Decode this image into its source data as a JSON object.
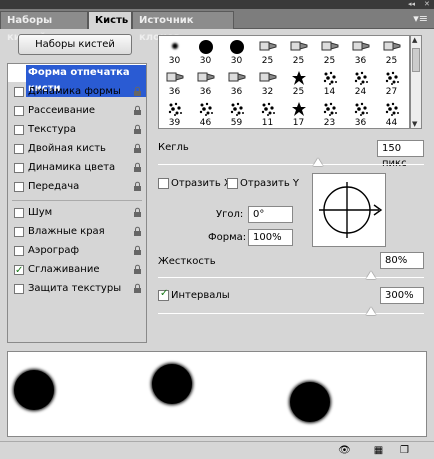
{
  "window": {
    "collapse_icon": "double-arrow-icon",
    "close_icon": "close-icon"
  },
  "tabs": [
    {
      "label": "Наборы кистей",
      "active": false
    },
    {
      "label": "Кисть",
      "active": true
    },
    {
      "label": "Источник клонов",
      "active": false
    }
  ],
  "panel_menu_icon": "panel-menu-icon",
  "presets_button": "Наборы кистей",
  "left_list": {
    "header": "Форма отпечатка кисти",
    "items": [
      {
        "label": "Динамика формы",
        "checked": false,
        "locked": true
      },
      {
        "label": "Рассеивание",
        "checked": false,
        "locked": true
      },
      {
        "label": "Текстура",
        "checked": false,
        "locked": true
      },
      {
        "label": "Двойная кисть",
        "checked": false,
        "locked": true
      },
      {
        "label": "Динамика цвета",
        "checked": false,
        "locked": true
      },
      {
        "label": "Передача",
        "checked": false,
        "locked": true
      },
      {
        "label": "Шум",
        "checked": false,
        "locked": true
      },
      {
        "label": "Влажные края",
        "checked": false,
        "locked": true
      },
      {
        "label": "Аэрограф",
        "checked": false,
        "locked": true
      },
      {
        "label": "Сглаживание",
        "checked": true,
        "locked": true
      },
      {
        "label": "Защита текстуры",
        "checked": false,
        "locked": true
      }
    ]
  },
  "brush_grid": {
    "rows": [
      [
        {
          "n": "30",
          "s": "soft"
        },
        {
          "n": "30",
          "s": "hard"
        },
        {
          "n": "30",
          "s": "hard"
        },
        {
          "n": "25",
          "s": "tip"
        },
        {
          "n": "25",
          "s": "tip"
        },
        {
          "n": "25",
          "s": "tip"
        },
        {
          "n": "36",
          "s": "tip"
        },
        {
          "n": "25",
          "s": "tip"
        }
      ],
      [
        {
          "n": "36",
          "s": "tip"
        },
        {
          "n": "36",
          "s": "tip"
        },
        {
          "n": "36",
          "s": "tip"
        },
        {
          "n": "32",
          "s": "tip"
        },
        {
          "n": "25",
          "s": "leaf"
        },
        {
          "n": "14",
          "s": "spray"
        },
        {
          "n": "24",
          "s": "spray"
        },
        {
          "n": "27",
          "s": "spray"
        }
      ],
      [
        {
          "n": "39",
          "s": "spray"
        },
        {
          "n": "46",
          "s": "spray"
        },
        {
          "n": "59",
          "s": "spray"
        },
        {
          "n": "11",
          "s": "spray"
        },
        {
          "n": "17",
          "s": "leaf"
        },
        {
          "n": "23",
          "s": "spray"
        },
        {
          "n": "36",
          "s": "spray"
        },
        {
          "n": "44",
          "s": "spray"
        }
      ]
    ]
  },
  "size": {
    "label": "Кегль",
    "value": "150 пикс",
    "slider_fraction": 0.6
  },
  "flip_x": {
    "label": "Отразить X",
    "checked": false
  },
  "flip_y": {
    "label": "Отразить Y",
    "checked": false
  },
  "angle": {
    "label": "Угол:",
    "value": "0°"
  },
  "roundness": {
    "label": "Форма:",
    "value": "100%"
  },
  "hardness": {
    "label": "Жесткость",
    "value": "80%",
    "slider_fraction": 0.8
  },
  "spacing": {
    "label": "Интервалы",
    "value": "300%",
    "checked": true,
    "slider_fraction": 0.8
  },
  "bottom_icons": [
    "eye-icon",
    "new-preset-icon",
    "new-page-icon"
  ]
}
